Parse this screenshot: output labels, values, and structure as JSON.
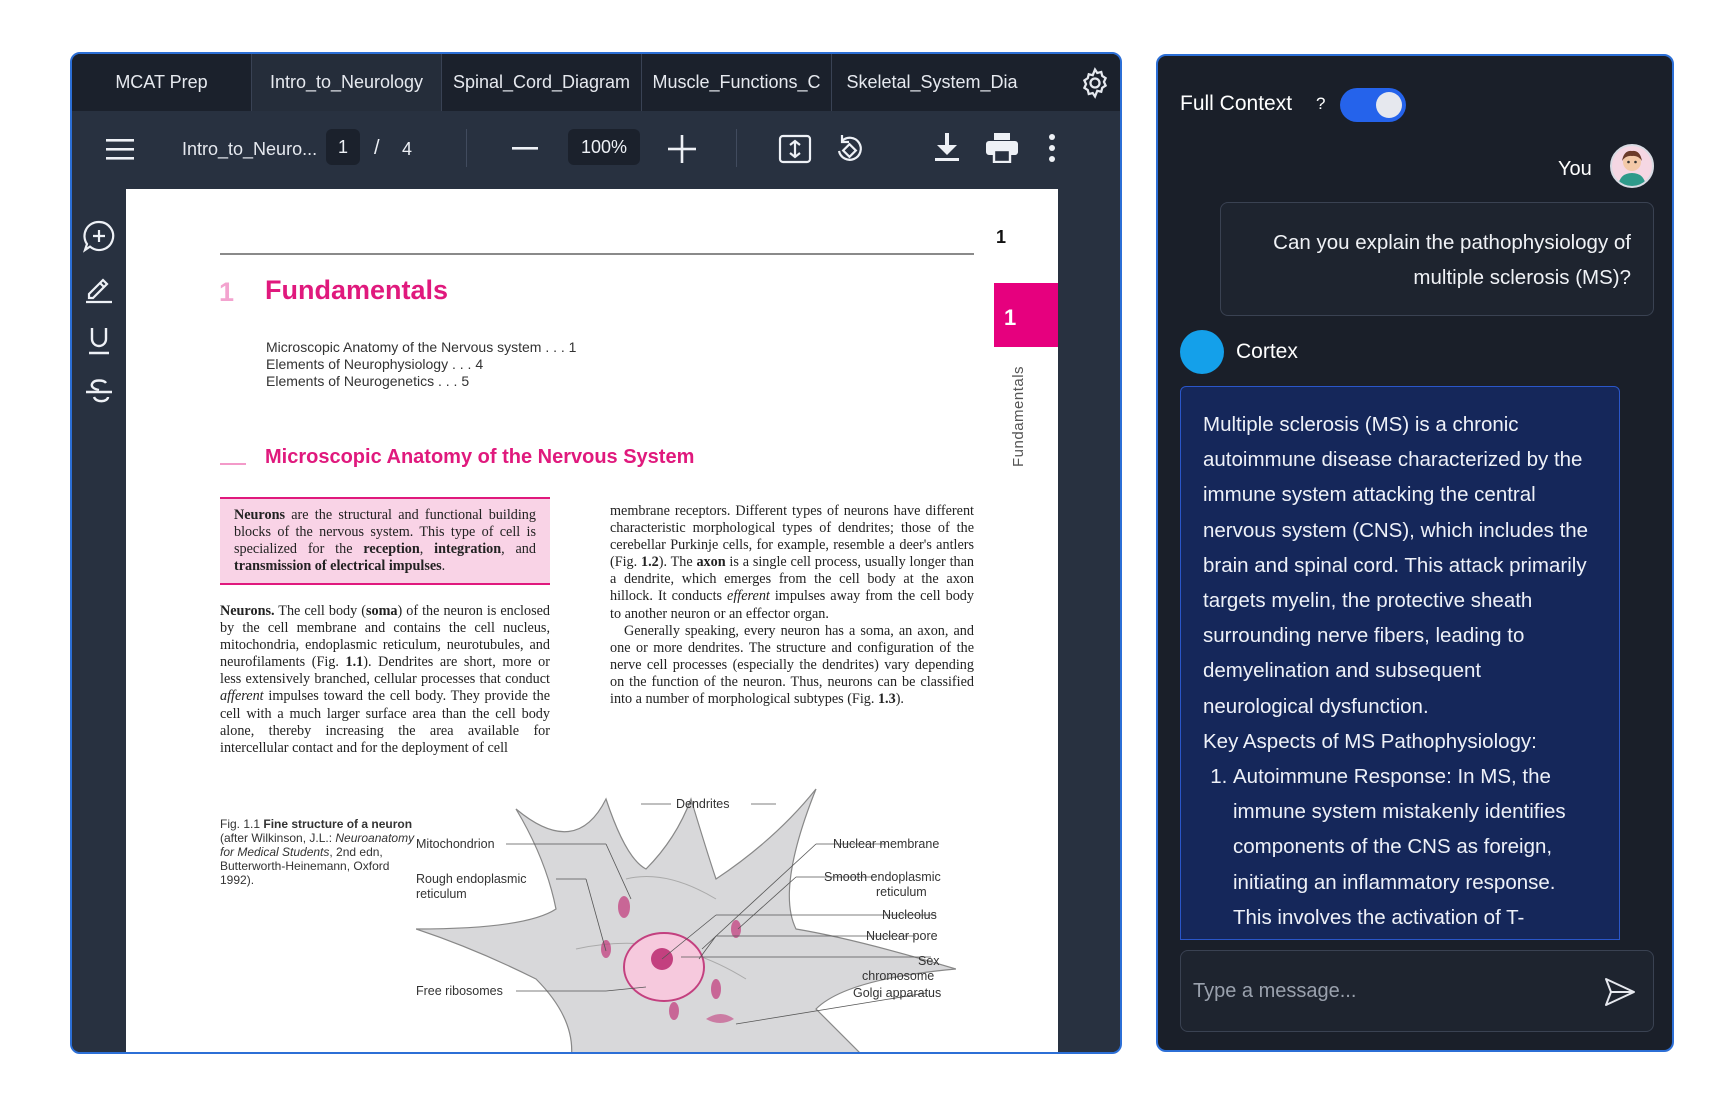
{
  "viewer": {
    "tabs": [
      {
        "label": "MCAT Prep"
      },
      {
        "label": "Intro_to_Neurology"
      },
      {
        "label": "Spinal_Cord_Diagram"
      },
      {
        "label": "Muscle_Functions_C"
      },
      {
        "label": "Skeletal_System_Dia"
      }
    ],
    "active_tab": "Intro_to_Neurology",
    "toolbar": {
      "filename": "Intro_to_Neuro...",
      "current_page": "1",
      "page_separator": "/",
      "total_pages": "4",
      "zoom": "100%"
    },
    "icons": {
      "menu": "menu-icon",
      "zoom_out": "minus-icon",
      "zoom_in": "plus-icon",
      "fit": "fit-page-icon",
      "rotate": "rotate-icon",
      "download": "download-icon",
      "print": "print-icon",
      "more": "more-vert-icon",
      "settings": "gear-icon",
      "rail": [
        "add-comment-icon",
        "highlight-pen-icon",
        "underline-icon",
        "strikethrough-icon"
      ]
    }
  },
  "document": {
    "page_number": "1",
    "chapter_number": "1",
    "chapter_title": "Fundamentals",
    "toc": [
      "Microscopic Anatomy of the Nervous system . . . 1",
      "Elements of Neurophysiology . . . 4",
      "Elements of Neurogenetics . . . 5"
    ],
    "side_tab_number": "1",
    "side_label": "Fundamentals",
    "section_title": "Microscopic Anatomy of the Nervous System",
    "definition": {
      "b1": "Neurons",
      "t1": " are the structural and functional building blocks of the nervous system. This type of cell is specialized for the ",
      "b2": "reception",
      "t2": ", ",
      "b3": "integration",
      "t3": ", and ",
      "b4": "transmission of electrical impulses",
      "t4": "."
    },
    "col1": {
      "b1": "Neurons.",
      "t1": " The cell body (",
      "b2": "soma",
      "t2": ") of the neuron is enclosed by the cell membrane and contains the cell nucleus, mitochondria, endoplasmic reticulum, neurotubules, and neurofilaments (Fig. ",
      "r1": "1.1",
      "t3": "). Dendrites are short, more or less extensively branched, cellular processes that conduct ",
      "i1": "afferent",
      "t4": " impulses toward the cell body. They provide the cell with a much larger surface area than the cell body alone, thereby increasing the area available for intercellular contact and for the deployment of cell"
    },
    "col2": {
      "t1": "membrane receptors. Different types of neurons have different characteristic morphological types of dendrites; those of the cerebellar Purkinje cells, for example, resemble a deer's antlers (Fig. ",
      "r1": "1.2",
      "t2": "). The ",
      "b1": "axon",
      "t3": " is a single cell process, usually longer than a dendrite, which emerges from the cell body at the axon hillock. It conducts ",
      "i1": "efferent",
      "t4": " impulses away from the cell body to another neuron or an effector organ.",
      "p2": "Generally speaking, every neuron has a soma, an axon, and one or more dendrites. The structure and configuration of the nerve cell processes (especially the dendrites) vary depending on the function of the neuron. Thus, neurons can be classified into a number of morphological subtypes (Fig. ",
      "r2": "1.3",
      "t5": ")."
    },
    "figure_caption": {
      "label": "Fig. 1.1",
      "title": "Fine structure of a neuron",
      "t1": "(after Wilkinson, J.L.: ",
      "i1": "Neuroanatomy for Medical Students",
      "t2": ", 2nd edn, Butterworth-Heinemann, Oxford 1992)."
    },
    "figure_labels": {
      "dendrites": "Dendrites",
      "mitochondrion": "Mitochondrion",
      "nuclear_membrane": "Nuclear membrane",
      "rough_er_1": "Rough endoplasmic",
      "rough_er_2": "reticulum",
      "smooth_er_1": "Smooth endoplasmic",
      "smooth_er_2": "reticulum",
      "nucleolus": "Nucleolus",
      "nuclear_pore": "Nuclear pore",
      "sex_1": "Sex",
      "sex_2": "chromosome",
      "free_ribosomes": "Free ribosomes",
      "golgi": "Golgi apparatus"
    }
  },
  "chat": {
    "full_context_label": "Full Context",
    "help": "?",
    "full_context_on": true,
    "user_name": "You",
    "user_message": "Can you explain the pathophysiology of multiple sclerosis (MS)?",
    "assistant_name": "Cortex",
    "assistant_paragraph": "Multiple sclerosis (MS) is a chronic autoimmune disease characterized by the immune system attacking the central nervous system (CNS), which includes the brain and spinal cord. This attack primarily targets myelin, the protective sheath surrounding nerve fibers, leading to demyelination and subsequent neurological dysfunction.",
    "assistant_heading": "Key Aspects of MS Pathophysiology:",
    "assistant_list": [
      "Autoimmune Response: In MS, the immune system mistakenly identifies components of the CNS as foreign, initiating an inflammatory response. This involves the activation of T-"
    ],
    "input_placeholder": "Type a message...",
    "colors": {
      "accent": "#2563eb",
      "assistant_bubble": "#15275a",
      "cortex_avatar": "#14a0ea"
    }
  }
}
